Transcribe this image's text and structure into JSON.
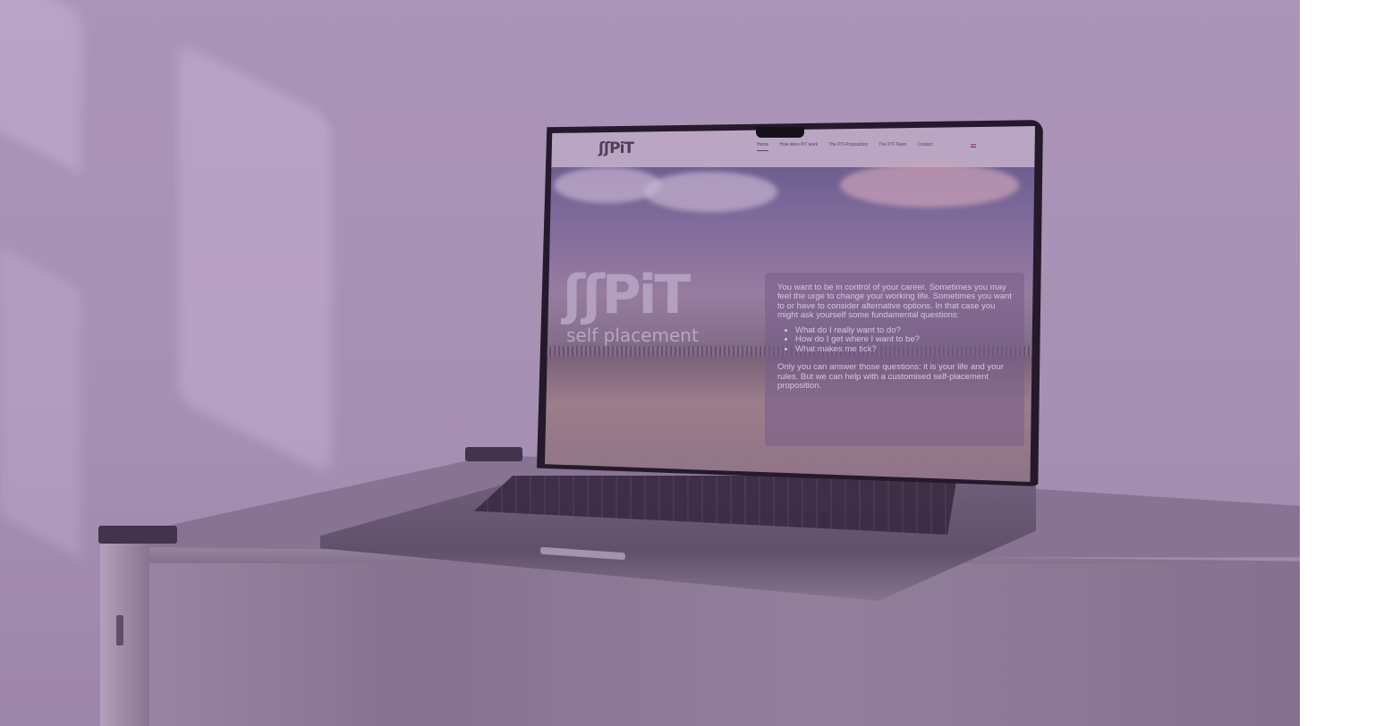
{
  "website": {
    "logo": "ʃʃPiT",
    "nav": [
      "Home",
      "How does PiT work",
      "The PiT-Proposition",
      "The PiT-Team",
      "Contact"
    ],
    "hero_logo": "ʃʃPiT",
    "tagline": "self placement",
    "intro": "You want to be in control of your career. Sometimes you may feel the urge to change your working life. Sometimes you want to or have to consider alternative options. In that case you might ask yourself some fundamental questions:",
    "questions": [
      "What do I really want to do?",
      "How do I get where I want to be?",
      "What makes me tick?"
    ],
    "outro": "Only you can answer those questions: it is your life and your rules. But we can help with a customised self-placement proposition."
  }
}
